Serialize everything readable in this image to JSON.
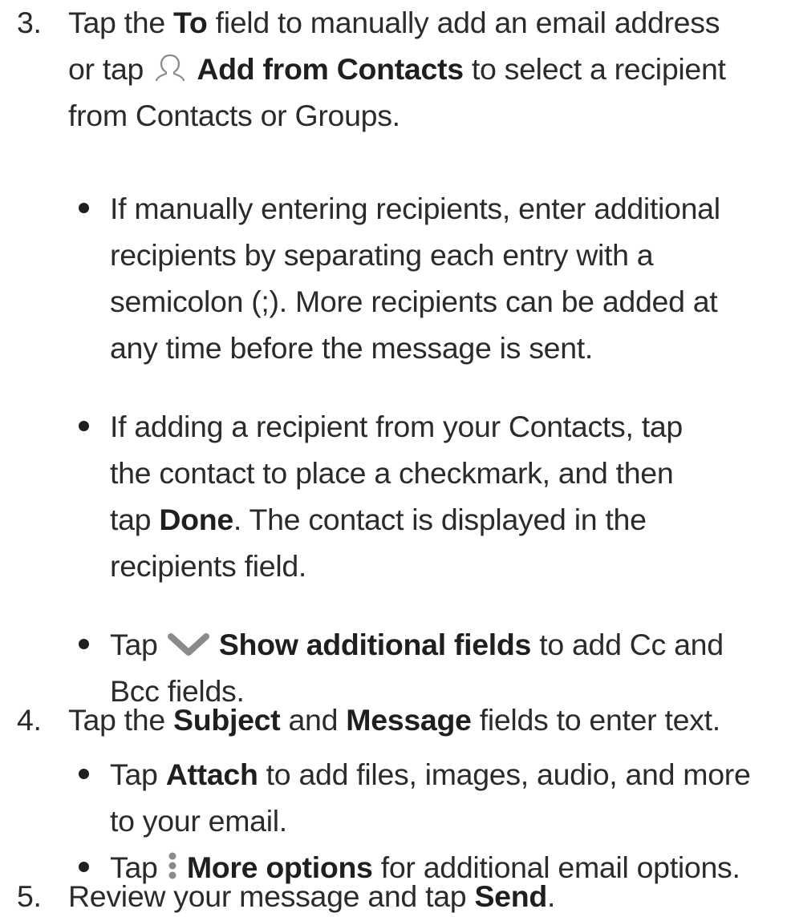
{
  "step3": {
    "number": "3.",
    "l1_pre": "Tap the ",
    "l1_bold": "To",
    "l1_post": " field to manually add an email address",
    "l2_pre": "or tap ",
    "l2_bold": "Add from Contacts",
    "l2_post": " to select a recipient",
    "l3": "from Contacts or Groups.",
    "bullet1": {
      "l1": "If manually entering recipients, enter additional",
      "l2": "recipients by separating each entry with a",
      "l3": "semicolon (;). More recipients can be added at",
      "l4": "any time before the message is sent."
    },
    "bullet2": {
      "l1": "If adding a recipient from your Contacts, tap",
      "l2": "the contact to place a checkmark, and then",
      "l3_pre": "tap ",
      "l3_bold": "Done",
      "l3_post": ". The contact is displayed in the",
      "l4": "recipients field."
    },
    "bullet3": {
      "l1_pre": "Tap ",
      "l1_bold": "Show additional fields",
      "l1_post": " to add Cc and",
      "l2": "Bcc fields."
    }
  },
  "step4": {
    "number": "4.",
    "l1_pre": "Tap the ",
    "l1_bold1": "Subject",
    "l1_mid": " and ",
    "l1_bold2": "Message",
    "l1_post": " fields to enter text.",
    "bullet1": {
      "l1_pre": "Tap ",
      "l1_bold": "Attach",
      "l1_post": " to add files, images, audio, and more",
      "l2": "to your email."
    },
    "bullet2": {
      "l1_pre": "Tap ",
      "l1_bold": "More options",
      "l1_post": " for additional email options."
    }
  },
  "step5": {
    "number": "5.",
    "l1_pre": "Review your message and tap ",
    "l1_bold": "Send",
    "l1_post": "."
  },
  "icons": {
    "contacts": "person-outline-icon",
    "expand": "chevron-down-icon",
    "more": "vertical-dots-icon"
  }
}
